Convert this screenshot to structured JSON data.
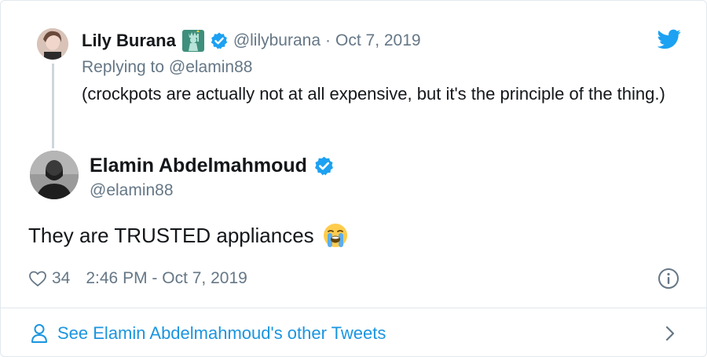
{
  "reply_tweet": {
    "author_name": "Lily Burana",
    "author_emoji": "statue-of-liberty-emoji",
    "handle": "@lilyburana",
    "separator": "·",
    "date": "Oct 7, 2019",
    "replying_to": "Replying to @elamin88",
    "text": "(crockpots are actually not at all expensive, but it's the principle of the thing.)"
  },
  "main_tweet": {
    "author_name": "Elamin Abdelmahmoud",
    "handle": "@elamin88",
    "text": "They are TRUSTED appliances",
    "text_emoji": "loudly-crying-face-emoji",
    "like_count": "34",
    "timestamp": "2:46 PM - Oct 7, 2019"
  },
  "footer": {
    "link_label": "See Elamin Abdelmahmoud's other Tweets"
  },
  "icons": {
    "twitter": "twitter-bird-icon",
    "verified": "verified-badge-icon",
    "like": "heart-icon",
    "info": "info-icon",
    "person": "person-icon",
    "chevron": "chevron-right-icon"
  },
  "colors": {
    "twitter_blue": "#1da1f2",
    "link_blue": "#1b95e0",
    "secondary_text": "#657786",
    "primary_text": "#14171a",
    "border": "#e1e8ed"
  }
}
